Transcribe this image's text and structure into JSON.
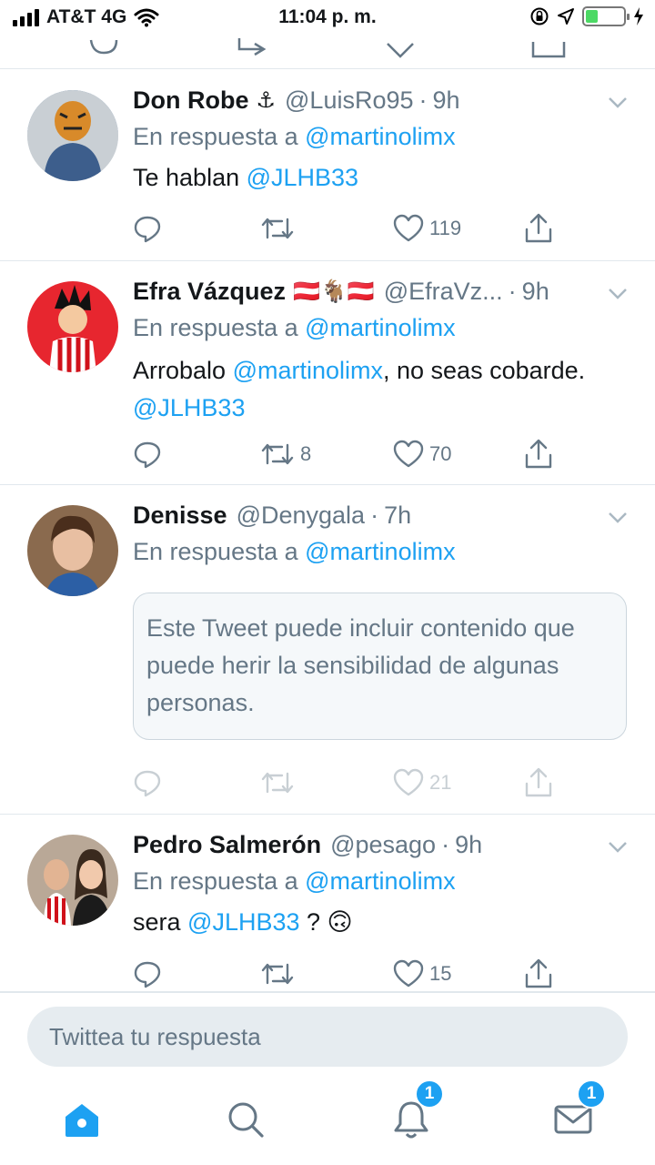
{
  "status_bar": {
    "carrier": "AT&T 4G",
    "time": "11:04 p. m."
  },
  "reply_prefix": "En respuesta a",
  "tweets": [
    {
      "name": "Don Robe",
      "name_emoji": "⚓",
      "handle": "@LuisRo95",
      "time": "9h",
      "reply_to": "@martinolimx",
      "text_before": "Te hablan ",
      "text_mention": "@JLHB33",
      "retweets": "",
      "likes": "119"
    },
    {
      "name": "Efra Vázquez",
      "name_emoji": "🇦🇹🐐🇦🇹",
      "handle": "@EfraVz...",
      "time": "9h",
      "reply_to": "@martinolimx",
      "text_before": "Arrobalo ",
      "text_mention": "@martinolimx",
      "text_after": ", no seas cobarde.",
      "text_mention2": "@JLHB33",
      "retweets": "8",
      "likes": "70"
    },
    {
      "name": "Denisse",
      "handle": "@Denygala",
      "time": "7h",
      "reply_to": "@martinolimx",
      "sensitive_notice": "Este Tweet puede incluir contenido que puede herir la sensibilidad de algunas personas.",
      "retweets": "",
      "likes": "21"
    },
    {
      "name": "Pedro Salmerón",
      "handle": "@pesago",
      "time": "9h",
      "reply_to": "@martinolimx",
      "text_before": "sera ",
      "text_mention": "@JLHB33",
      "text_after": " ? ",
      "text_emoji": "🙃",
      "retweets": "",
      "likes": "15"
    }
  ],
  "composer": {
    "placeholder": "Twittea tu respuesta"
  },
  "tabbar": {
    "notifications_badge": "1",
    "messages_badge": "1"
  },
  "colors": {
    "accent": "#1da1f2",
    "secondary_text": "#657786",
    "divider": "#e1e8ed"
  },
  "icons": [
    "reply-icon",
    "retweet-icon",
    "like-icon",
    "share-icon",
    "chevron-down-icon",
    "home-icon",
    "search-icon",
    "bell-icon",
    "mail-icon"
  ]
}
